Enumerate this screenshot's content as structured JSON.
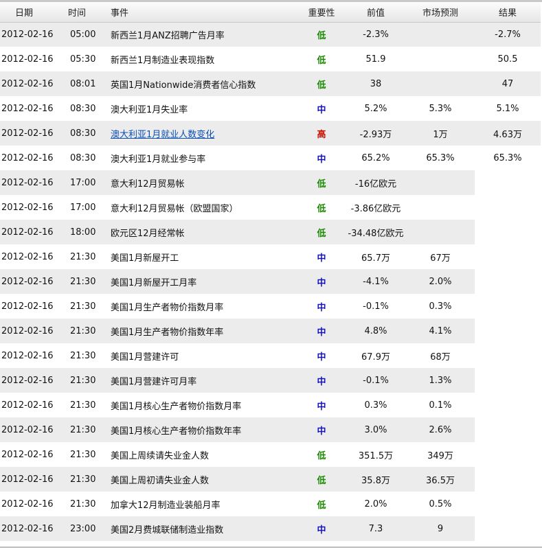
{
  "header": {
    "date": "日期",
    "time": "时间",
    "event": "事件",
    "importance": "重要性",
    "previous": "前值",
    "forecast": "市场预测",
    "actual": "结果"
  },
  "rows": [
    {
      "date": "2012-02-16",
      "time": "05:00",
      "event": "新西兰1月ANZ招聘广告月率",
      "importance": "低",
      "level": "low",
      "previous": "-2.3%",
      "forecast": "",
      "actual": "-2.7%",
      "link": false
    },
    {
      "date": "2012-02-16",
      "time": "05:30",
      "event": "新西兰1月制造业表现指数",
      "importance": "低",
      "level": "low",
      "previous": "51.9",
      "forecast": "",
      "actual": "50.5",
      "link": false
    },
    {
      "date": "2012-02-16",
      "time": "08:01",
      "event": "英国1月Nationwide消费者信心指数",
      "importance": "低",
      "level": "low",
      "previous": "38",
      "forecast": "",
      "actual": "47",
      "link": false
    },
    {
      "date": "2012-02-16",
      "time": "08:30",
      "event": "澳大利亚1月失业率",
      "importance": "中",
      "level": "mid",
      "previous": "5.2%",
      "forecast": "5.3%",
      "actual": "5.1%",
      "link": false
    },
    {
      "date": "2012-02-16",
      "time": "08:30",
      "event": "澳大利亚1月就业人数变化",
      "importance": "高",
      "level": "high",
      "previous": "-2.93万",
      "forecast": "1万",
      "actual": "4.63万",
      "link": true
    },
    {
      "date": "2012-02-16",
      "time": "08:30",
      "event": "澳大利亚1月就业参与率",
      "importance": "中",
      "level": "mid",
      "previous": "65.2%",
      "forecast": "65.3%",
      "actual": "65.3%",
      "link": false
    },
    {
      "date": "2012-02-16",
      "time": "17:00",
      "event": "意大利12月贸易帐",
      "importance": "低",
      "level": "low",
      "previous": "-16亿欧元",
      "forecast": "",
      "actual": "",
      "link": false
    },
    {
      "date": "2012-02-16",
      "time": "17:00",
      "event": "意大利12月贸易帐（欧盟国家）",
      "importance": "低",
      "level": "low",
      "previous": "-3.86亿欧元",
      "forecast": "",
      "actual": "",
      "link": false
    },
    {
      "date": "2012-02-16",
      "time": "18:00",
      "event": "欧元区12月经常帐",
      "importance": "低",
      "level": "low",
      "previous": "-34.48亿欧元",
      "forecast": "",
      "actual": "",
      "link": false
    },
    {
      "date": "2012-02-16",
      "time": "21:30",
      "event": "美国1月新屋开工",
      "importance": "中",
      "level": "mid",
      "previous": "65.7万",
      "forecast": "67万",
      "actual": "",
      "link": false
    },
    {
      "date": "2012-02-16",
      "time": "21:30",
      "event": "美国1月新屋开工月率",
      "importance": "中",
      "level": "mid",
      "previous": "-4.1%",
      "forecast": "2.0%",
      "actual": "",
      "link": false
    },
    {
      "date": "2012-02-16",
      "time": "21:30",
      "event": "美国1月生产者物价指数月率",
      "importance": "中",
      "level": "mid",
      "previous": "-0.1%",
      "forecast": "0.3%",
      "actual": "",
      "link": false
    },
    {
      "date": "2012-02-16",
      "time": "21:30",
      "event": "美国1月生产者物价指数年率",
      "importance": "中",
      "level": "mid",
      "previous": "4.8%",
      "forecast": "4.1%",
      "actual": "",
      "link": false
    },
    {
      "date": "2012-02-16",
      "time": "21:30",
      "event": "美国1月营建许可",
      "importance": "中",
      "level": "mid",
      "previous": "67.9万",
      "forecast": "68万",
      "actual": "",
      "link": false
    },
    {
      "date": "2012-02-16",
      "time": "21:30",
      "event": "美国1月营建许可月率",
      "importance": "中",
      "level": "mid",
      "previous": "-0.1%",
      "forecast": "1.3%",
      "actual": "",
      "link": false
    },
    {
      "date": "2012-02-16",
      "time": "21:30",
      "event": "美国1月核心生产者物价指数月率",
      "importance": "中",
      "level": "mid",
      "previous": "0.3%",
      "forecast": "0.1%",
      "actual": "",
      "link": false
    },
    {
      "date": "2012-02-16",
      "time": "21:30",
      "event": "美国1月核心生产者物价指数年率",
      "importance": "中",
      "level": "mid",
      "previous": "3.0%",
      "forecast": "2.6%",
      "actual": "",
      "link": false
    },
    {
      "date": "2012-02-16",
      "time": "21:30",
      "event": "美国上周续请失业金人数",
      "importance": "低",
      "level": "low",
      "previous": "351.5万",
      "forecast": "349万",
      "actual": "",
      "link": false
    },
    {
      "date": "2012-02-16",
      "time": "21:30",
      "event": "美国上周初请失业金人数",
      "importance": "低",
      "level": "low",
      "previous": "35.8万",
      "forecast": "36.5万",
      "actual": "",
      "link": false
    },
    {
      "date": "2012-02-16",
      "time": "21:30",
      "event": "加拿大12月制造业装船月率",
      "importance": "低",
      "level": "low",
      "previous": "2.0%",
      "forecast": "0.5%",
      "actual": "",
      "link": false
    },
    {
      "date": "2012-02-16",
      "time": "23:00",
      "event": "美国2月费城联储制造业指数",
      "importance": "中",
      "level": "mid",
      "previous": "7.3",
      "forecast": "9",
      "actual": "",
      "link": false
    }
  ],
  "colors": {
    "low": "#1a8a00",
    "mid": "#1410c4",
    "high": "#c81000",
    "link": "#0b4fb4",
    "row_shade": "#ececec"
  }
}
